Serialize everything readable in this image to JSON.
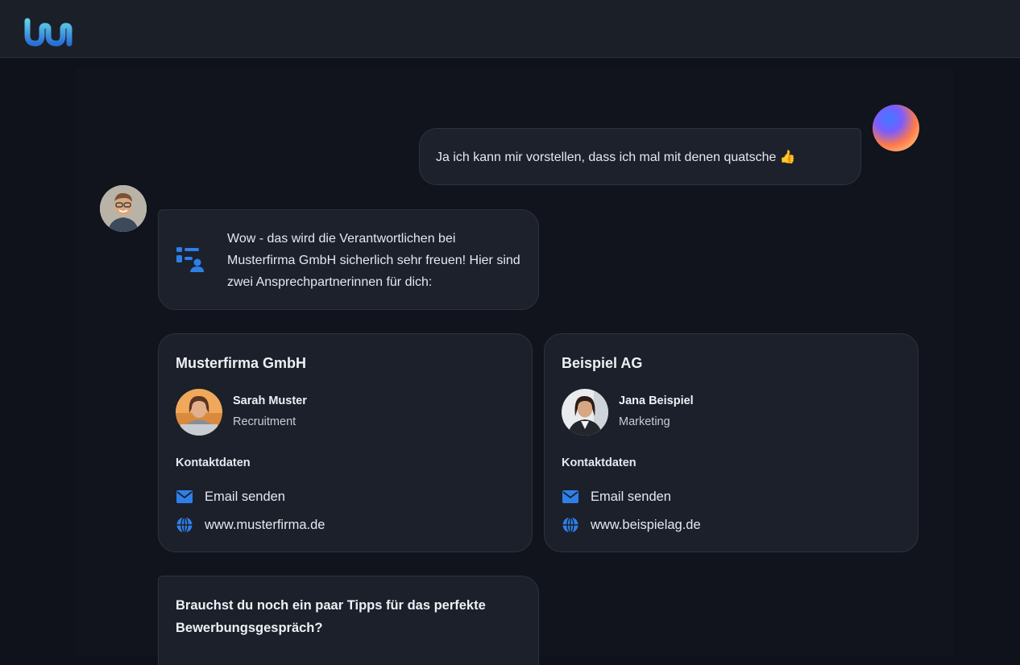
{
  "app": {
    "logo_icon": "wave-logo-icon"
  },
  "conversation": {
    "user_message": "Ja ich kann mir vorstellen, dass ich mal mit denen quatsche 👍",
    "assistant_message": "Wow - das wird die Verantwortlichen bei Musterfirma GmbH sicherlich sehr freuen! Hier sind zwei Ansprechpartnerinnen für dich:",
    "assistant_message_icon": "team-icon",
    "tips_question": "Brauchst du noch ein paar Tipps für das perfekte Bewerbungsgespräch?"
  },
  "cards": [
    {
      "company": "Musterfirma GmbH",
      "person_name": "Sarah Muster",
      "person_role": "Recruitment",
      "contact_heading": "Kontaktdaten",
      "email_label": "Email senden",
      "website": "www.musterfirma.de"
    },
    {
      "company": "Beispiel AG",
      "person_name": "Jana Beispiel",
      "person_role": "Marketing",
      "contact_heading": "Kontaktdaten",
      "email_label": "Email senden",
      "website": "www.beispielag.de"
    }
  ],
  "colors": {
    "accent": "#2f7fe8",
    "background": "#0f121a",
    "bubble": "#1c212c"
  }
}
